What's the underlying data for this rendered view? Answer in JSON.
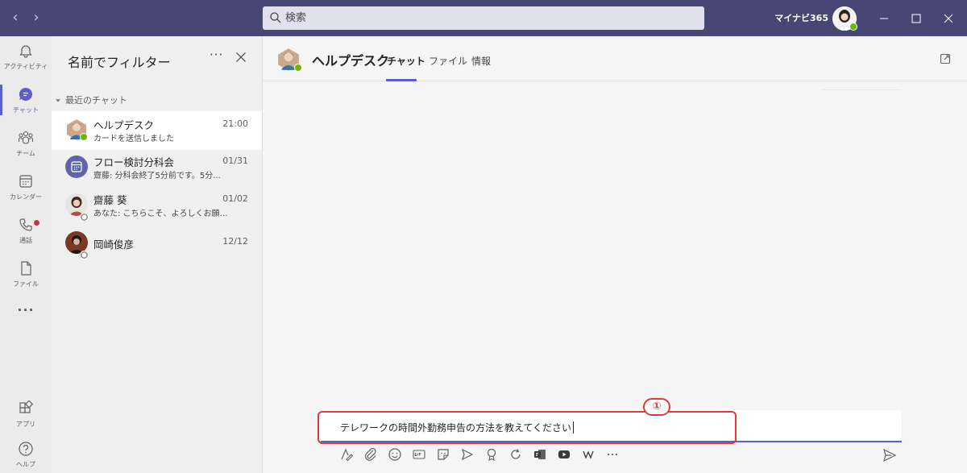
{
  "titlebar": {
    "search_placeholder": "検索",
    "tenant": "マイナビ365",
    "back_arrow": "‹",
    "forward_arrow": "›"
  },
  "rail": {
    "items": [
      {
        "label": "アクティビティ",
        "icon": "bell-icon"
      },
      {
        "label": "チャット",
        "icon": "chat-icon"
      },
      {
        "label": "チーム",
        "icon": "teams-icon"
      },
      {
        "label": "カレンダー",
        "icon": "calendar-icon"
      },
      {
        "label": "通話",
        "icon": "phone-icon"
      },
      {
        "label": "ファイル",
        "icon": "file-icon"
      }
    ],
    "more": "···",
    "bottom": [
      {
        "label": "アプリ",
        "icon": "apps-icon"
      },
      {
        "label": "ヘルプ",
        "icon": "help-icon"
      }
    ]
  },
  "chatlist": {
    "filter_title": "名前でフィルター",
    "more": "···",
    "section": "最近のチャット",
    "chats": [
      {
        "name": "ヘルプデスク",
        "time": "21:00",
        "preview": "カードを送信しました"
      },
      {
        "name": "フロー検討分科会",
        "time": "01/31",
        "preview": "齋藤: 分科会終了5分前です。5分..."
      },
      {
        "name": "齋藤 葵",
        "time": "01/02",
        "preview": "あなた: こちらこそ、よろしくお願いします。"
      },
      {
        "name": "岡崎俊彦",
        "time": "12/12",
        "preview": ""
      }
    ]
  },
  "main": {
    "title": "ヘルプデスク",
    "tabs": [
      "チャット",
      "ファイル",
      "情報"
    ],
    "compose_text": "テレワークの時間外勤務申告の方法を教えてください",
    "callout": "①"
  },
  "colors": {
    "titlebar": "#464775",
    "accent": "#5b5fc7",
    "highlight": "#e03a3a",
    "presence": "#6bb700"
  }
}
